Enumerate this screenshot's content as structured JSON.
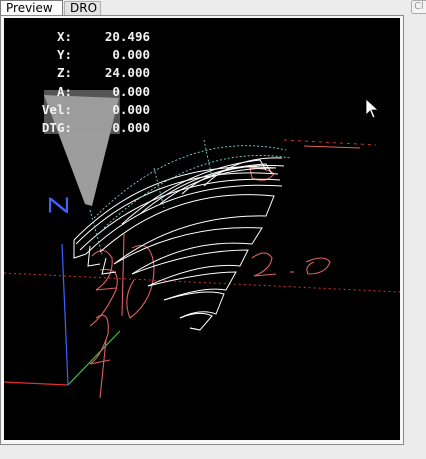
{
  "tabs": {
    "preview": "Preview",
    "dro": "DRO"
  },
  "right_stub_label": "Cl",
  "dro": [
    {
      "label": "X:",
      "value": "20.496"
    },
    {
      "label": "Y:",
      "value": "0.000"
    },
    {
      "label": "Z:",
      "value": "24.000"
    },
    {
      "label": "A:",
      "value": "0.000"
    },
    {
      "label": "Vel:",
      "value": "0.000"
    },
    {
      "label": "DTG:",
      "value": "0.000"
    }
  ],
  "colors": {
    "viewport_bg": "#000000",
    "toolpath": "#ffffff",
    "rapid": "#7fd4d4",
    "gcode_text": "#e06060",
    "x_axis": "#e03030",
    "y_axis": "#40c040",
    "z_axis": "#4060ff",
    "tool_cone": "#cccccc"
  }
}
